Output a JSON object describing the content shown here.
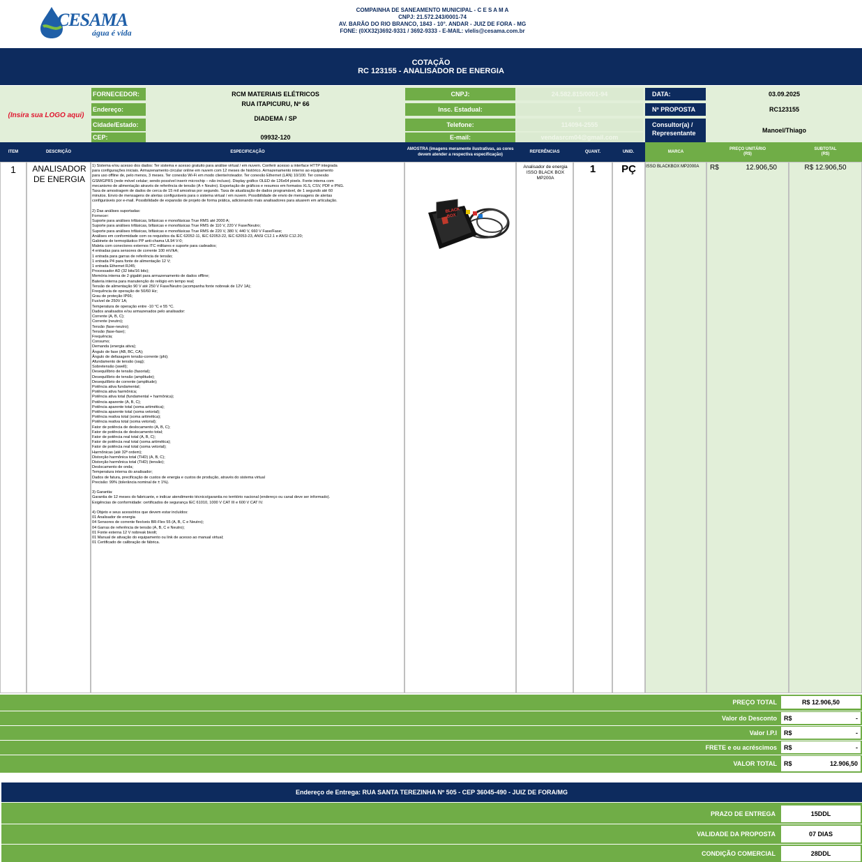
{
  "company": {
    "logo_text": "CESAMA",
    "logo_sub": "água é vida",
    "lines": [
      "COMPAINHA DE SANEAMENTO MUNICIPAL - C E S A M A",
      "CNPJ: 21.572.243/0001-74",
      "AV. BARÃO DO RIO BRANCO, 1843 - 10°. ANDAR - JUIZ DE FORA - MG",
      "FONE: (0XX32)3692-9331 / 3692-9333 - E-MAIL: vlelis@cesama.com.br"
    ]
  },
  "title": {
    "line1": "COTAÇÃO",
    "line2": "RC 123155 - ANALISADOR DE ENERGIA"
  },
  "supplier": {
    "logo_placeholder": "(Insira sua LOGO aqui)",
    "fornecedor_label": "FORNECEDOR:",
    "fornecedor_value": "RCM MATERIAIS ELÉTRICOS",
    "endereco_label": "Endereço:",
    "endereco_value": "RUA ITAPICURU, Nº 66",
    "cidade_label": "Cidade/Estado:",
    "cidade_value": "DIADEMA / SP",
    "cep_label": "CEP:",
    "cep_value": "09932-120",
    "cnpj_label": "CNPJ:",
    "cnpj_value": "24.582.815/0001-94",
    "insc_label": "Insc. Estadual:",
    "insc_value": "1",
    "telefone_label": "Telefone:",
    "telefone_value": "114094-2555",
    "email_label": "E-mail:",
    "email_value": "vendasrcm04@gmail.com",
    "data_label": "DATA:",
    "data_value": "03.09.2025",
    "proposta_label": "Nº PROPOSTA",
    "proposta_value": "RC123155",
    "consultor_label": "Consultor(a) / Representante",
    "consultor_value": "Manoel/Thiago"
  },
  "columns": {
    "item": "ITEM",
    "descricao": "DESCRIÇÃO",
    "especificacao": "ESPECIFICAÇÃO",
    "amostra": "AMOSTRA (imagens meramente ilustrativas, as cores devem atender a respectiva especificação)",
    "referencias": "REFERÊNCIAS",
    "quant": "QUANT.",
    "unid": "UNID.",
    "marca": "MARCA",
    "preco": "PREÇO UNITÁRIO (R$)",
    "subtotal": "SUBTOTAL (R$)"
  },
  "item": {
    "number": "1",
    "description": "ANALISADOR DE ENERGIA",
    "references": "Analisador de energia ISSO BLACK BOX MP200A",
    "quantity": "1",
    "unit": "PÇ",
    "brand": "ISSO BLACKBOX MP2000A",
    "currency": "R$",
    "unit_price": "12.906,50",
    "subtotal": "R$ 12.906,50",
    "sample_label": "BLACK BOX",
    "spec_text": "1) Sistema e/ou acesso dos dados: Ter sistema e acesso gratuito para análise virtual / em nuvem. Conferir acesso a interface HTTP integrada\npara configurações iniciais. Armazenamento circular online em nuvem com 12 meses de histórico. Armazenamento interno ao equipamento\npara uso offline de, pelo menos, 3 meses. Ter conexão Wi-Fi em modo cliente/roteador. Ter conexão Ethernet (LAN) 10/100. Ter conexão\nGSM/GPRS (rede móvel celular; sendo possível inserir microchip – não incluso). Display gráfico OLED de 126x64 pixels. Fonte interna com\nmecanismo de alimentação através de referência de tensão (A + Neutro). Exportação de gráficos e resumos em formatos XLS, CSV, PDF e PNG.\nTaxa de amostragem de dados de cerca de 15 mil amostras por segundo. Taxa de atualização de dados programável, de 1 segundo até 60\nminutos. Envio de mensagens de alertas configuráveis para o sistema virtual / em nuvem. Possibilidade de envio de mensagens de alertas\nconfiguráveis por e-mail. Possibilidade de expansão de projeto de forma prática, adicionando mais analisadores para atuarem em articulação.\n\n2) Das análises suportadas:\nFornecer:\nSuporte para análises trifásicas, bifásicas e monofásicas True RMS até 2000 A;\nSuporte para análises trifásicas, bifásicas e monofásicas True RMS de 110 V, 220 V Fase/Neutro;\nSuporte para análises trifásicas, bifásicas e monofásicas True RMS de 220 V, 380 V, 440 V, 660 V Fase/Fase;\nAnálises em conformidade com os requisitos da IEC 62052-11, IEC 62053-22, IEC 62053-23, ANSI C12.1 e ANSI C12.20;\nGabinete de termoplástico PP anti-chama UL94 V-0;\nMaleta com conectores externos ITC militares e suporte para cadeados;\n4 entradas para sensores de corrente 100 mV/kA;\n1 entrada para garras de referência de tensão;\n1 entrada P4 para fonte de alimentação 12 V;\n1 entrada Ethernet RJ45;\nProcessador AD (32 bits/16 bits);\nMemória interna de 2 gigabit para armazenamento de dados offline;\nBateria interna para manutenção do relógio em tempo real;\nTensão de alimentação 90 V até 250 V Fase/Neutro (acompanha fonte nobreak de 12V 1A);\nFrequência de operação de 50/60 Hz;\nGrau de proteção IP66;\nFusível de 250V 1A;\nTemperatura de operação entre -10 °C e 55 °C.\nDados analisados e/ou armazenados pelo analisador:\nCorrente (A, B, C);\nCorrente (neutro);\nTensão (fase-neutro);\nTensão (fase-fase);\nFrequência;\nConsumo;\nDemanda (energia ativa);\nÂngulo de fase (AB, BC, CA);\nÂngulo de defasagem tensão-corrente (phi);\nAfundamento de tensão (sag);\nSobretensão (swell);\nDesequilíbrio de tensão (fasorial);\nDesequilíbrio de tensão (amplitude);\nDesequilíbrio de corrente (amplitude);\nPotência ativa fundamental;\nPotência ativa harmônica;\nPotência ativa total (fundamental + harmônica);\nPotência aparente (A, B, C);\nPotência aparente total (soma aritmética);\nPotência aparente total (soma vetorial);\nPotência reativa total (soma aritmética);\nPotência reativa total (soma vetorial);\nFator de potência de deslocamento (A, B, C);\nFator de potência de deslocamento total;\nFator de potência real total (A, B, C);\nFator de potência real total (soma aritmética);\nFator de potência real total (soma vetorial);\nHarmônicas (até 32ª ordem);\nDistorção harmônica total (THD) (A, B, C);\nDistorção harmônica total (THD) (tensão);\nDeslocamento de onda;\nTemperatura interna do analisador;\nDados de fatura, precificação de custos de energia e custos de produção, através do sistema virtual\nPrecisão: 99% (tolerância nominal de ± 1%).\n\n3) Garantia:\nGarantia de 12 meses do fabricante, e indicar atendimento técnico/garantia no território nacional (endereço ou canal deve ser informado).\nExigências de conformidade: certificados de segurança IEC 61010, 1000 V CAT III e 600 V CAT IV.\n\n4) Objeto e seus acessórios que devem estar incluídos:\n01 Analisador de energia\n04 Sensores de corrente flexíveis BR-Flex 55 (A, B, C e Neutro);\n04 Garras de referência de tensão (A, B, C e Neutro);\n01 Fonte externa 12 V nobreak bivolt;\n01 Manual de ativação do equipamento ou link de acesso ao manual virtual;\n01 Certificado de calibração de fábrica."
  },
  "totals": {
    "preco_total_label": "PREÇO TOTAL",
    "preco_total_value": "R$ 12.906,50",
    "desconto_label": "Valor do Desconto",
    "desconto_currency": "R$",
    "desconto_value": "-",
    "ipi_label": "Valor I.P.I",
    "ipi_currency": "R$",
    "ipi_value": "-",
    "frete_label": "FRETE e ou acréscimos",
    "frete_currency": "R$",
    "frete_value": "-",
    "valor_total_label": "VALOR TOTAL",
    "valor_total_currency": "R$",
    "valor_total_value": "12.906,50"
  },
  "delivery": {
    "address": "Endereço de Entrega: RUA SANTA TEREZINHA Nº 505 - CEP 36045-490 - JUIZ DE FORA/MG",
    "prazo_label": "PRAZO DE ENTREGA",
    "prazo_value": "15DDL",
    "validade_label": "VALIDADE DA PROPOSTA",
    "validade_value": "07 DIAS",
    "condicao_label": "CONDIÇÃO COMERCIAL",
    "condicao_value": "28DDL"
  },
  "colors": {
    "navy": "#0d2b5e",
    "green": "#70ad47",
    "light_green": "#e2efd9",
    "logo_blue": "#1f5fa8",
    "placeholder_red": "#e0152e"
  }
}
